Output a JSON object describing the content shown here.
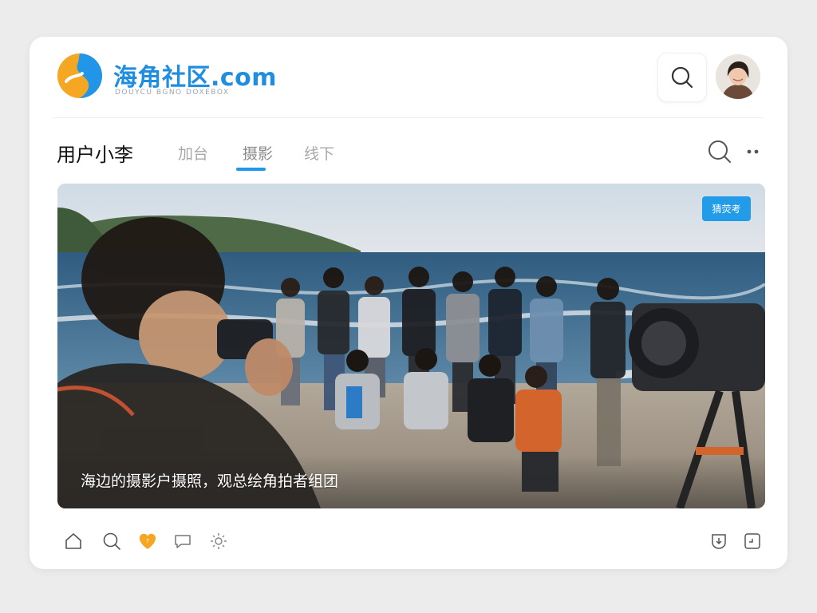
{
  "header": {
    "brand": "海角社区.com",
    "brand_sub": "DOUYCU BGNO DOXEBOX",
    "logo_icon": "circle-swirl-logo",
    "search_icon": "search-icon",
    "colors": {
      "brand": "#1f8ee0",
      "logo_orange": "#f5a623",
      "logo_blue": "#2196e8"
    }
  },
  "profile": {
    "username": "用户小李",
    "tabs": [
      {
        "label": "加台",
        "active": false
      },
      {
        "label": "摄影",
        "active": true
      },
      {
        "label": "线下",
        "active": false
      }
    ]
  },
  "post": {
    "badge": "猜荧考",
    "caption": "海边的摄影户摄照，观总绘角拍者组团",
    "colors": {
      "badge": "#229be8"
    }
  },
  "bottom_bar": {
    "icons_left": [
      "home-icon",
      "search-icon",
      "heart-badge-icon",
      "comment-icon",
      "settings-icon"
    ],
    "icons_right": [
      "download-icon",
      "share-icon"
    ]
  }
}
